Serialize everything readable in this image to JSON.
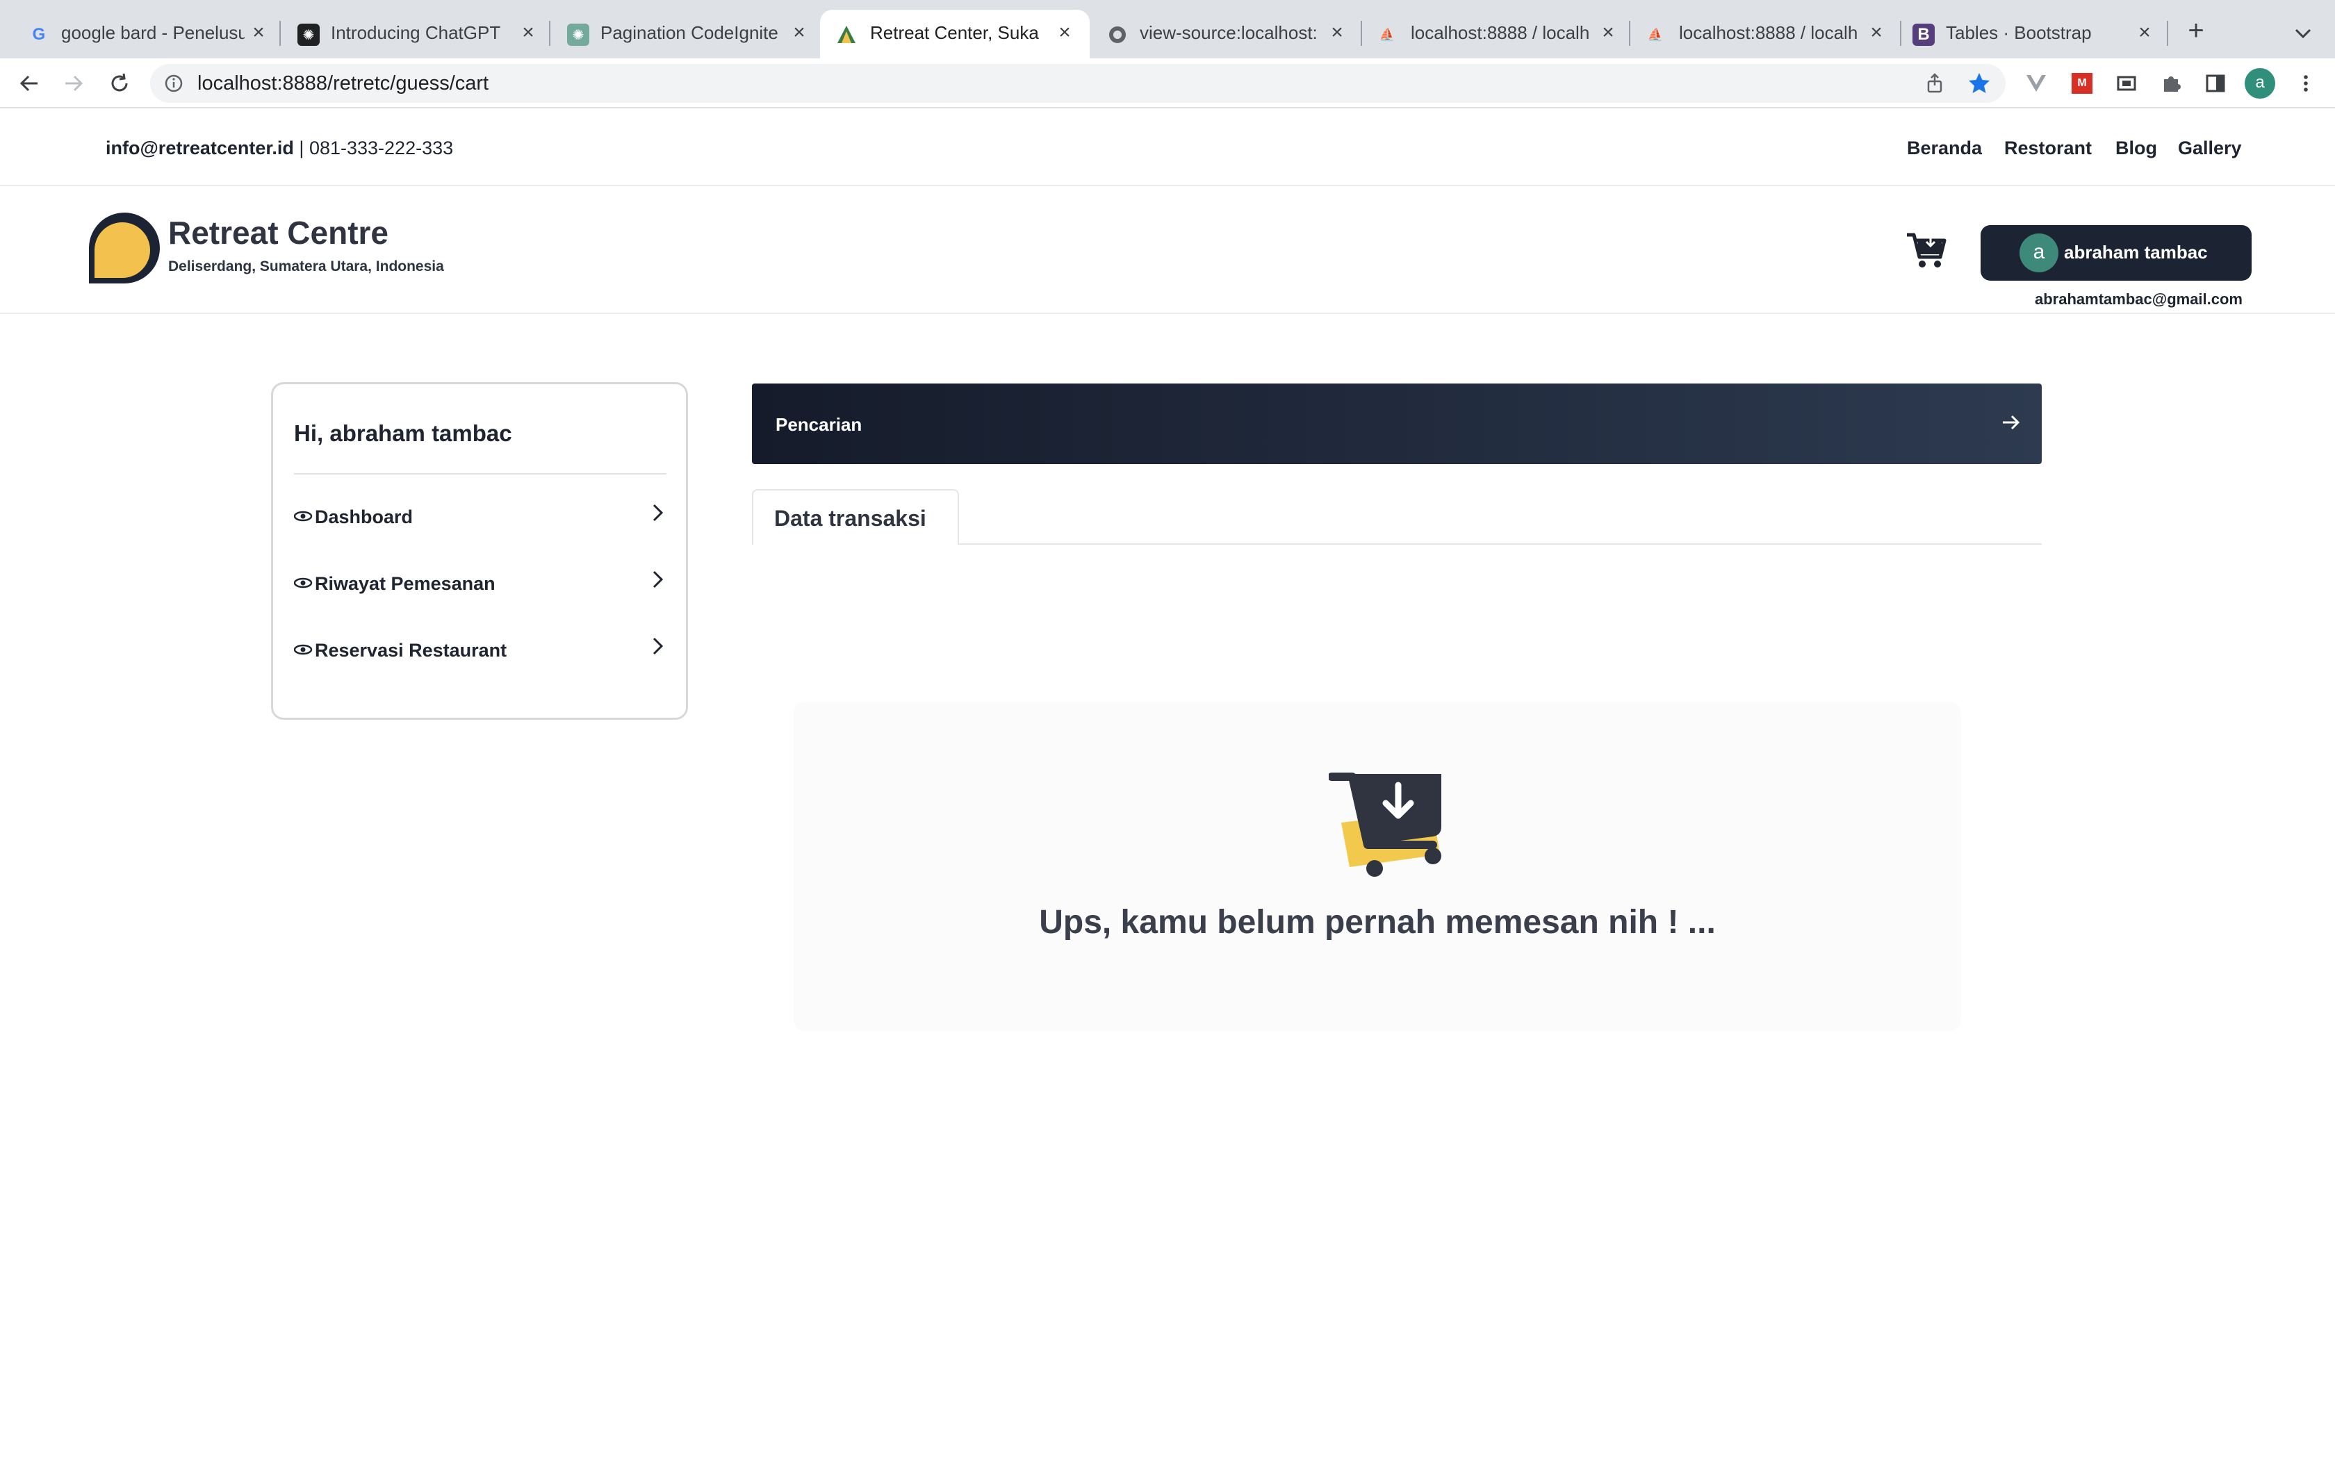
{
  "browser": {
    "tabs": [
      {
        "title": "google bard - Penelusu",
        "icon": "google-icon"
      },
      {
        "title": "Introducing ChatGPT",
        "icon": "openai-icon"
      },
      {
        "title": "Pagination CodeIgniter",
        "icon": "openai-icon"
      },
      {
        "title": "Retreat Center, Suka M",
        "icon": "retreat-icon",
        "active": true
      },
      {
        "title": "view-source:localhost:",
        "icon": "globe-icon"
      },
      {
        "title": "localhost:8888 / localh",
        "icon": "phpmyadmin-icon"
      },
      {
        "title": "localhost:8888 / localh",
        "icon": "phpmyadmin-icon"
      },
      {
        "title": "Tables · Bootstrap",
        "icon": "bootstrap-icon"
      }
    ],
    "url": "localhost:8888/retretc/guess/cart",
    "profile_initial": "a"
  },
  "topbar": {
    "email": "info@retreatcenter.id",
    "separator": "|",
    "phone": "081-333-222-333",
    "nav": [
      "Beranda",
      "Restorant",
      "Blog",
      "Gallery"
    ]
  },
  "header": {
    "brand_name": "Retreat Centre",
    "brand_subtitle": "Deliserdang, Sumatera Utara, Indonesia",
    "user_initial": "a",
    "user_name": "abraham tambac",
    "user_email": "abrahamtambac@gmail.com"
  },
  "sidebar": {
    "greeting": "Hi, abraham tambac",
    "items": [
      {
        "label": "Dashboard"
      },
      {
        "label": "Riwayat Pemesanan"
      },
      {
        "label": "Reservasi Restaurant"
      }
    ]
  },
  "main": {
    "search_label": "Pencarian",
    "tab_label": "Data transaksi",
    "empty_message": "Ups, kamu belum pernah memesan nih ! ..."
  },
  "colors": {
    "brand_dark": "#1c2333",
    "brand_yellow": "#f2c14e",
    "avatar_green": "#3d8a7a",
    "star_blue": "#1a73e8"
  }
}
